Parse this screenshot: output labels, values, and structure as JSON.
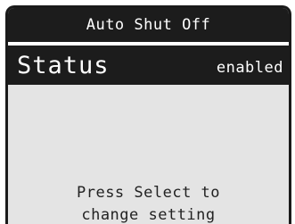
{
  "header": {
    "title": "Auto Shut Off"
  },
  "setting": {
    "label": "Status",
    "value": "enabled"
  },
  "instructions": {
    "line1": "Press Select to",
    "line2": "change setting"
  },
  "colors": {
    "bar_background": "#1c1c1c",
    "bar_text": "#ffffff",
    "screen_background": "#e4e4e4",
    "body_text": "#222222"
  }
}
